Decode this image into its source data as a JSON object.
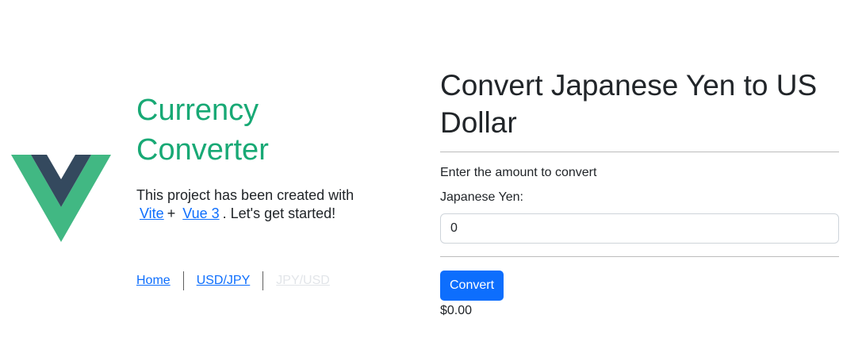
{
  "header": {
    "title": "Currency Converter",
    "subtitle_prefix": "This project has been created with",
    "subtitle_link_vite": "Vite",
    "subtitle_plus": "+",
    "subtitle_link_vue": "Vue 3",
    "subtitle_suffix": ". Let's get started!",
    "logo_colors": {
      "outer": "#41b883",
      "inner": "#34495e"
    }
  },
  "nav": {
    "items": [
      {
        "label": "Home",
        "active": true
      },
      {
        "label": "USD/JPY",
        "active": true
      },
      {
        "label": "JPY/USD",
        "active": false
      }
    ]
  },
  "converter": {
    "title": "Convert Japanese Yen to US Dollar",
    "prompt": "Enter the amount to convert",
    "field_label": "Japanese Yen:",
    "amount_value": "0",
    "button_label": "Convert",
    "result": "$0.00"
  },
  "colors": {
    "accent": "#18a975",
    "link": "#0d6efd",
    "button": "#0d6efd"
  }
}
